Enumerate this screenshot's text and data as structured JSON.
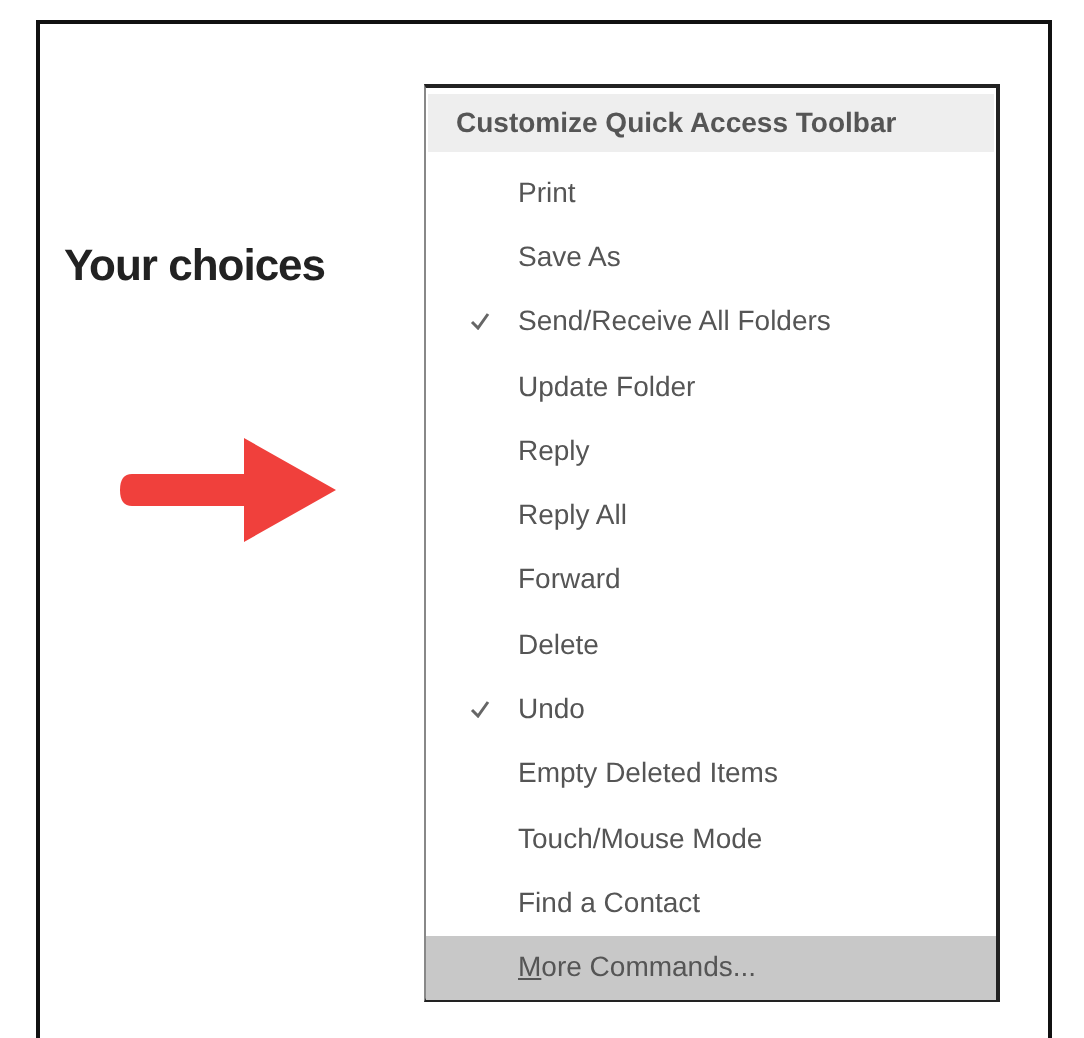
{
  "caption": "Your choices",
  "menu": {
    "title": "Customize Quick Access Toolbar",
    "items": [
      {
        "label": "Print",
        "checked": false,
        "selected": false
      },
      {
        "label": "Save As",
        "checked": false,
        "selected": false
      },
      {
        "label": "Send/Receive All Folders",
        "checked": true,
        "selected": false
      },
      {
        "label": "Update Folder",
        "checked": false,
        "selected": false
      },
      {
        "label": "Reply",
        "checked": false,
        "selected": false
      },
      {
        "label": "Reply All",
        "checked": false,
        "selected": false
      },
      {
        "label": "Forward",
        "checked": false,
        "selected": false
      },
      {
        "label": "Delete",
        "checked": false,
        "selected": false
      },
      {
        "label": "Undo",
        "checked": true,
        "selected": false
      },
      {
        "label": "Empty Deleted Items",
        "checked": false,
        "selected": false
      },
      {
        "label": "Touch/Mouse Mode",
        "checked": false,
        "selected": false
      },
      {
        "label": "Find a Contact",
        "checked": false,
        "selected": false
      },
      {
        "label": "More Commands...",
        "checked": false,
        "selected": true,
        "access_key_underlined": true
      }
    ]
  }
}
